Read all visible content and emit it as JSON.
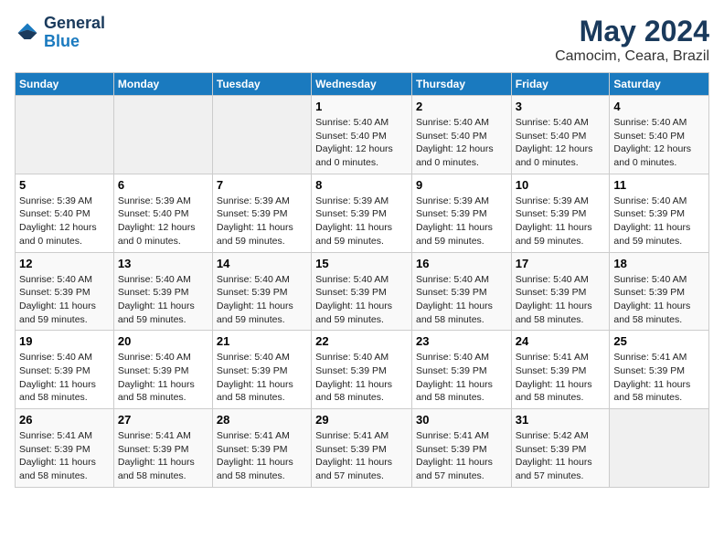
{
  "logo": {
    "text_general": "General",
    "text_blue": "Blue"
  },
  "title": "May 2024",
  "subtitle": "Camocim, Ceara, Brazil",
  "headers": [
    "Sunday",
    "Monday",
    "Tuesday",
    "Wednesday",
    "Thursday",
    "Friday",
    "Saturday"
  ],
  "weeks": [
    [
      {
        "day": "",
        "info": ""
      },
      {
        "day": "",
        "info": ""
      },
      {
        "day": "",
        "info": ""
      },
      {
        "day": "1",
        "info": "Sunrise: 5:40 AM\nSunset: 5:40 PM\nDaylight: 12 hours and 0 minutes."
      },
      {
        "day": "2",
        "info": "Sunrise: 5:40 AM\nSunset: 5:40 PM\nDaylight: 12 hours and 0 minutes."
      },
      {
        "day": "3",
        "info": "Sunrise: 5:40 AM\nSunset: 5:40 PM\nDaylight: 12 hours and 0 minutes."
      },
      {
        "day": "4",
        "info": "Sunrise: 5:40 AM\nSunset: 5:40 PM\nDaylight: 12 hours and 0 minutes."
      }
    ],
    [
      {
        "day": "5",
        "info": "Sunrise: 5:39 AM\nSunset: 5:40 PM\nDaylight: 12 hours and 0 minutes."
      },
      {
        "day": "6",
        "info": "Sunrise: 5:39 AM\nSunset: 5:40 PM\nDaylight: 12 hours and 0 minutes."
      },
      {
        "day": "7",
        "info": "Sunrise: 5:39 AM\nSunset: 5:39 PM\nDaylight: 11 hours and 59 minutes."
      },
      {
        "day": "8",
        "info": "Sunrise: 5:39 AM\nSunset: 5:39 PM\nDaylight: 11 hours and 59 minutes."
      },
      {
        "day": "9",
        "info": "Sunrise: 5:39 AM\nSunset: 5:39 PM\nDaylight: 11 hours and 59 minutes."
      },
      {
        "day": "10",
        "info": "Sunrise: 5:39 AM\nSunset: 5:39 PM\nDaylight: 11 hours and 59 minutes."
      },
      {
        "day": "11",
        "info": "Sunrise: 5:40 AM\nSunset: 5:39 PM\nDaylight: 11 hours and 59 minutes."
      }
    ],
    [
      {
        "day": "12",
        "info": "Sunrise: 5:40 AM\nSunset: 5:39 PM\nDaylight: 11 hours and 59 minutes."
      },
      {
        "day": "13",
        "info": "Sunrise: 5:40 AM\nSunset: 5:39 PM\nDaylight: 11 hours and 59 minutes."
      },
      {
        "day": "14",
        "info": "Sunrise: 5:40 AM\nSunset: 5:39 PM\nDaylight: 11 hours and 59 minutes."
      },
      {
        "day": "15",
        "info": "Sunrise: 5:40 AM\nSunset: 5:39 PM\nDaylight: 11 hours and 59 minutes."
      },
      {
        "day": "16",
        "info": "Sunrise: 5:40 AM\nSunset: 5:39 PM\nDaylight: 11 hours and 58 minutes."
      },
      {
        "day": "17",
        "info": "Sunrise: 5:40 AM\nSunset: 5:39 PM\nDaylight: 11 hours and 58 minutes."
      },
      {
        "day": "18",
        "info": "Sunrise: 5:40 AM\nSunset: 5:39 PM\nDaylight: 11 hours and 58 minutes."
      }
    ],
    [
      {
        "day": "19",
        "info": "Sunrise: 5:40 AM\nSunset: 5:39 PM\nDaylight: 11 hours and 58 minutes."
      },
      {
        "day": "20",
        "info": "Sunrise: 5:40 AM\nSunset: 5:39 PM\nDaylight: 11 hours and 58 minutes."
      },
      {
        "day": "21",
        "info": "Sunrise: 5:40 AM\nSunset: 5:39 PM\nDaylight: 11 hours and 58 minutes."
      },
      {
        "day": "22",
        "info": "Sunrise: 5:40 AM\nSunset: 5:39 PM\nDaylight: 11 hours and 58 minutes."
      },
      {
        "day": "23",
        "info": "Sunrise: 5:40 AM\nSunset: 5:39 PM\nDaylight: 11 hours and 58 minutes."
      },
      {
        "day": "24",
        "info": "Sunrise: 5:41 AM\nSunset: 5:39 PM\nDaylight: 11 hours and 58 minutes."
      },
      {
        "day": "25",
        "info": "Sunrise: 5:41 AM\nSunset: 5:39 PM\nDaylight: 11 hours and 58 minutes."
      }
    ],
    [
      {
        "day": "26",
        "info": "Sunrise: 5:41 AM\nSunset: 5:39 PM\nDaylight: 11 hours and 58 minutes."
      },
      {
        "day": "27",
        "info": "Sunrise: 5:41 AM\nSunset: 5:39 PM\nDaylight: 11 hours and 58 minutes."
      },
      {
        "day": "28",
        "info": "Sunrise: 5:41 AM\nSunset: 5:39 PM\nDaylight: 11 hours and 58 minutes."
      },
      {
        "day": "29",
        "info": "Sunrise: 5:41 AM\nSunset: 5:39 PM\nDaylight: 11 hours and 57 minutes."
      },
      {
        "day": "30",
        "info": "Sunrise: 5:41 AM\nSunset: 5:39 PM\nDaylight: 11 hours and 57 minutes."
      },
      {
        "day": "31",
        "info": "Sunrise: 5:42 AM\nSunset: 5:39 PM\nDaylight: 11 hours and 57 minutes."
      },
      {
        "day": "",
        "info": ""
      }
    ]
  ]
}
